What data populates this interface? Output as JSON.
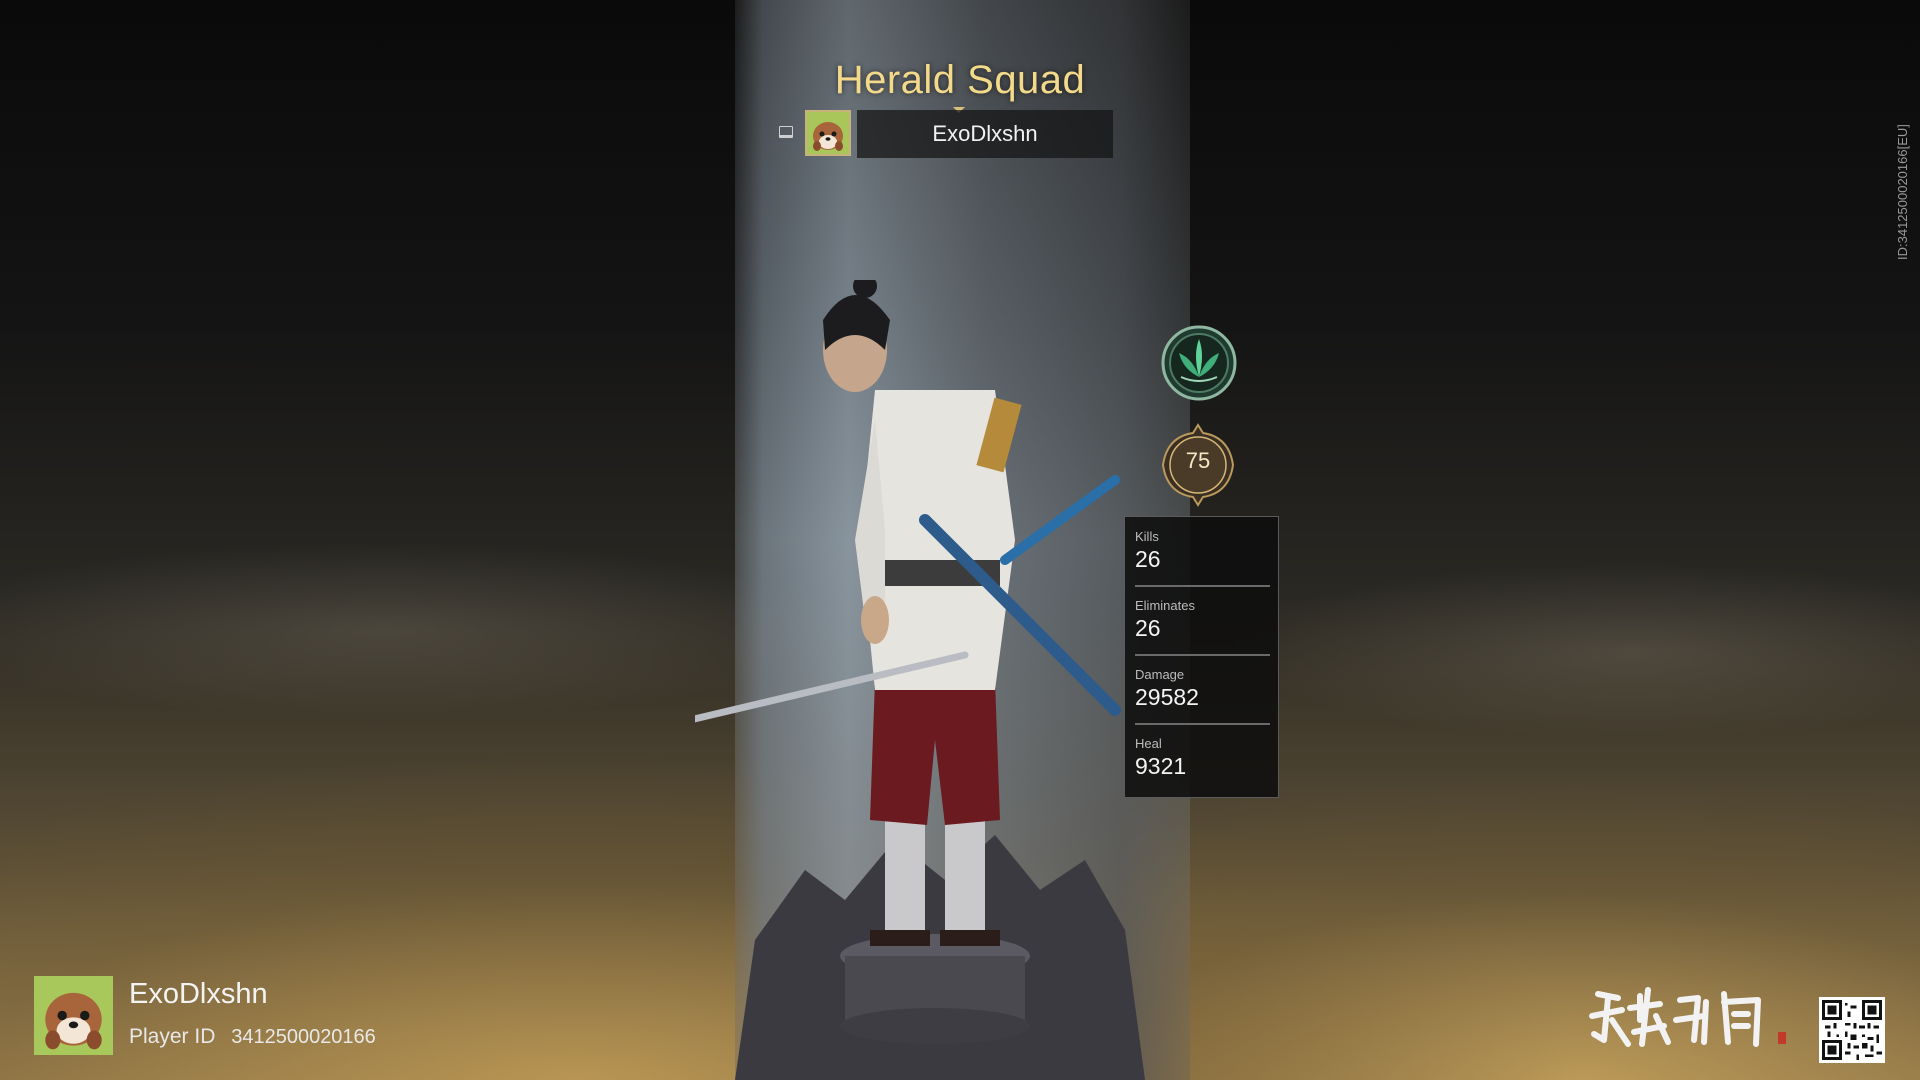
{
  "header": {
    "squad_title": "Herald Squad"
  },
  "squad_member": {
    "name": "ExoDlxshn",
    "platform_icon": "pc-monitor-icon"
  },
  "rank": {
    "emblem_icon": "lotus-leaf-rank-icon",
    "level": "75"
  },
  "stats": [
    {
      "label": "Kills",
      "value": "26"
    },
    {
      "label": "Eliminates",
      "value": "26"
    },
    {
      "label": "Damage",
      "value": "29582"
    },
    {
      "label": "Heal",
      "value": "9321"
    }
  ],
  "side_id": "ID:3412500020166[EU]",
  "player": {
    "name": "ExoDlxshn",
    "id_label": "Player ID",
    "id_value": "3412500020166"
  },
  "branding": {
    "logo_icon": "game-calligraphy-logo",
    "qr_icon": "qr-code-icon"
  },
  "colors": {
    "title_gold": "#f3d98a",
    "avatar_green": "#a9c85c",
    "panel_bg": "#0e0e0e"
  }
}
